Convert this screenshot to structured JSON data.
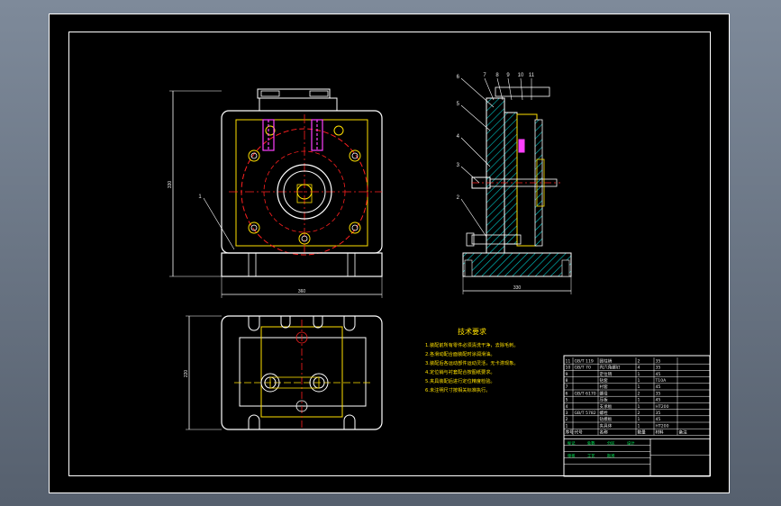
{
  "drawing": {
    "tech_title": "技术要求",
    "tech_lines": [
      "1.装配前所有零件必须清洗干净，去除毛刺。",
      "2.各滑动配合面装配时涂润滑油。",
      "3.装配后各运动部件运动灵活，无卡滞现象。",
      "4.定位销与衬套配合按图纸要求。",
      "5.夹具装配后进行定位精度检验。",
      "6.未注明尺寸按相关标准执行。"
    ],
    "front_view": {
      "dim_width": "360",
      "dim_height": "330",
      "leader_labels": [
        "1"
      ]
    },
    "side_view": {
      "dim_width": "330",
      "leader_labels": [
        "6",
        "5",
        "4",
        "3",
        "2",
        "7",
        "8",
        "9",
        "10",
        "11"
      ]
    },
    "top_view": {
      "dim_height": "220"
    },
    "title_block": {
      "header": [
        "序号",
        "代号",
        "名称",
        "数量",
        "材料",
        "备注"
      ],
      "rows": [
        [
          "11",
          "GB/T 119",
          "圆柱销",
          "2",
          "35",
          ""
        ],
        [
          "10",
          "GB/T 70",
          "内六角螺钉",
          "4",
          "35",
          ""
        ],
        [
          "9",
          "",
          "定位销",
          "1",
          "45",
          ""
        ],
        [
          "8",
          "",
          "钻套",
          "1",
          "T10A",
          ""
        ],
        [
          "7",
          "",
          "衬套",
          "1",
          "45",
          ""
        ],
        [
          "6",
          "GB/T 6170",
          "螺母",
          "2",
          "35",
          ""
        ],
        [
          "5",
          "",
          "压板",
          "1",
          "45",
          ""
        ],
        [
          "4",
          "",
          "支承板",
          "1",
          "HT200",
          ""
        ],
        [
          "3",
          "GB/T 5782",
          "螺栓",
          "2",
          "35",
          ""
        ],
        [
          "2",
          "",
          "钻模板",
          "1",
          "45",
          ""
        ],
        [
          "1",
          "",
          "夹具体",
          "1",
          "HT200",
          ""
        ]
      ],
      "footer_labels": [
        "标记",
        "处数",
        "分区",
        "设计",
        "审核",
        "工艺",
        "批准"
      ]
    }
  }
}
